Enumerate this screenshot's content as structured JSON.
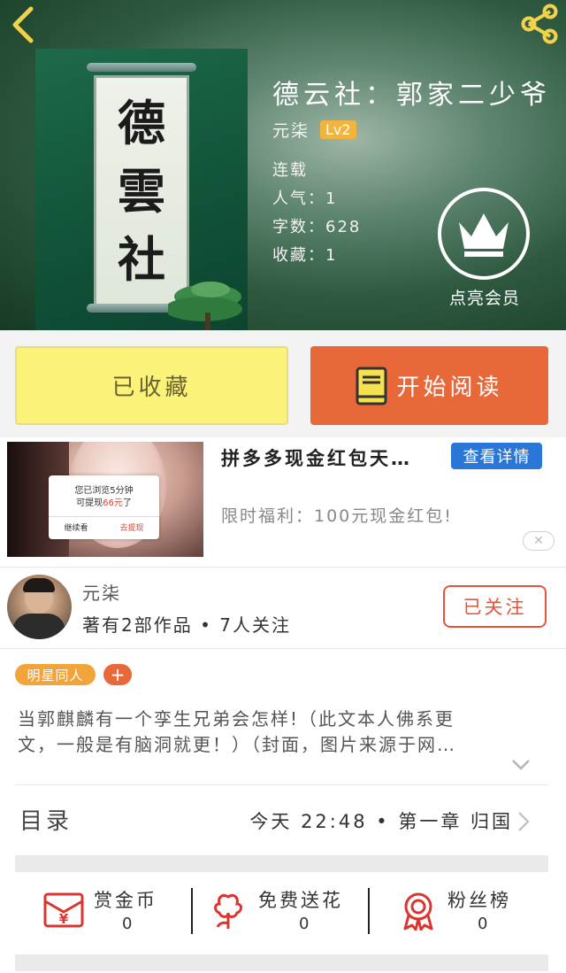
{
  "header": {
    "book_title": "德云社：郭家二少爷",
    "author": "元柒",
    "level": "Lv2",
    "status": "连载",
    "popularity": "人气：1",
    "word_count": "字数：628",
    "favorites": "收藏：1",
    "vip_label": "点亮会员",
    "cover_chars": [
      "德",
      "雲",
      "社"
    ]
  },
  "actions": {
    "collected_label": "已收藏",
    "read_label": "开始阅读"
  },
  "ad": {
    "title": "拼多多现金红包天…",
    "detail_button": "查看详情",
    "description": "限时福利：100元现金红包!",
    "dialog_line1": "您已浏览5分钟",
    "dialog_line2_prefix": "可提现",
    "dialog_line2_amount": "66元",
    "dialog_line2_suffix": "了",
    "dialog_btn_continue": "继续看",
    "dialog_btn_withdraw": "去提现",
    "close": "✕"
  },
  "author_card": {
    "name": "元柒",
    "stats": "著有2部作品 • 7人关注",
    "follow_label": "已关注"
  },
  "tags": {
    "items": [
      "明星同人"
    ],
    "add": "+"
  },
  "intro": {
    "line1": "当郭麒麟有一个孪生兄弟会怎样!（此文本人佛系更",
    "line2": "文，一般是有脑洞就更！）（封面，图片来源于网…"
  },
  "toc": {
    "label": "目录",
    "latest": "今天 22:48 • 第一章 归国"
  },
  "bottom_stats": [
    {
      "label": "赏金币",
      "value": "0",
      "icon": "red-envelope-icon"
    },
    {
      "label": "免费送花",
      "value": "0",
      "icon": "flower-icon"
    },
    {
      "label": "粉丝榜",
      "value": "0",
      "icon": "medal-icon"
    }
  ],
  "colors": {
    "accent_orange": "#e9683a",
    "collected_yellow": "#fbf27a",
    "tag_orange": "#f2a33a",
    "ad_blue": "#2a77d8",
    "icon_red": "#d9362f"
  }
}
